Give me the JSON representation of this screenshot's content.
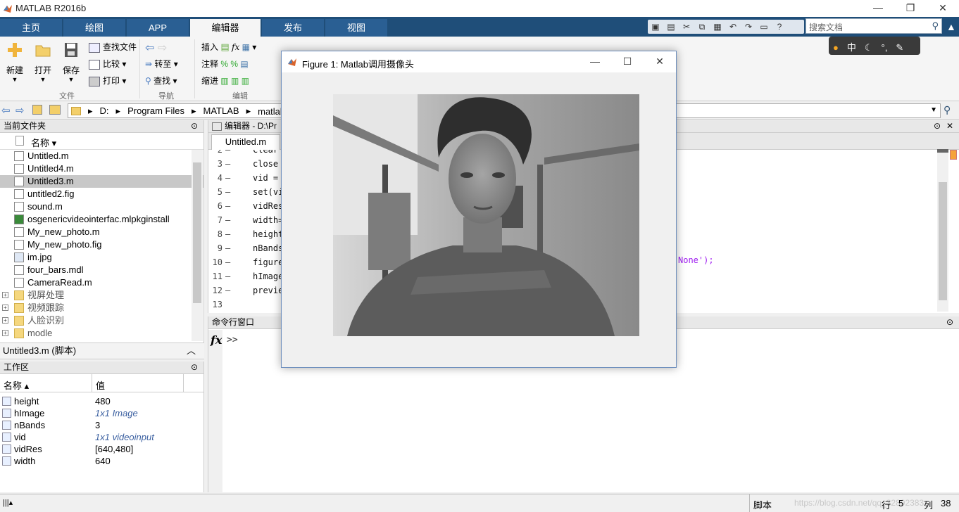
{
  "window": {
    "title": "MATLAB R2016b",
    "min": "—",
    "max": "❐",
    "close": "✕"
  },
  "tabs": [
    "主页",
    "绘图",
    "APP",
    "编辑器",
    "发布",
    "视图"
  ],
  "search": {
    "placeholder": "搜索文档"
  },
  "ribbon": {
    "new": "新建",
    "open": "打开",
    "save": "保存",
    "find_files": "查找文件",
    "compare": "比较",
    "print": "打印",
    "goto": "转至",
    "find": "查找",
    "insert": "插入",
    "comment": "注释",
    "indent": "缩进",
    "group_file": "文件",
    "group_nav": "导航",
    "group_edit": "编辑"
  },
  "lang_bar": {
    "label": "中"
  },
  "path": [
    "D:",
    "Program Files",
    "MATLAB",
    "matlab代码"
  ],
  "file_panel": {
    "title": "当前文件夹",
    "col_name": "名称",
    "files": [
      {
        "name": "Untitled.m",
        "type": "m"
      },
      {
        "name": "Untitled4.m",
        "type": "m"
      },
      {
        "name": "Untitled3.m",
        "type": "m",
        "selected": true
      },
      {
        "name": "untitled2.fig",
        "type": "fig"
      },
      {
        "name": "sound.m",
        "type": "m"
      },
      {
        "name": "osgenericvideointerfac.mlpkginstall",
        "type": "pkg"
      },
      {
        "name": "My_new_photo.m",
        "type": "m"
      },
      {
        "name": "My_new_photo.fig",
        "type": "fig"
      },
      {
        "name": "im.jpg",
        "type": "jpg"
      },
      {
        "name": "four_bars.mdl",
        "type": "mdl"
      },
      {
        "name": "CameraRead.m",
        "type": "m"
      }
    ],
    "folders": [
      "视屏处理",
      "视频跟踪",
      "人脸识别",
      "modle"
    ]
  },
  "details": {
    "label": "Untitled3.m  (脚本)"
  },
  "workspace": {
    "title": "工作区",
    "col_name": "名称",
    "col_value": "值",
    "vars": [
      {
        "name": "height",
        "value": "480",
        "obj": false
      },
      {
        "name": "hImage",
        "value": "1x1 Image",
        "obj": true
      },
      {
        "name": "nBands",
        "value": "3",
        "obj": false
      },
      {
        "name": "vid",
        "value": "1x1 videoinput",
        "obj": true
      },
      {
        "name": "vidRes",
        "value": "[640,480]",
        "obj": false
      },
      {
        "name": "width",
        "value": "640",
        "obj": false
      }
    ]
  },
  "editor": {
    "title": "编辑器 - D:\\Pr",
    "tab": "Untitled.m",
    "lines": [
      {
        "n": "2",
        "code": "clear"
      },
      {
        "n": "3",
        "code": "close"
      },
      {
        "n": "4",
        "code": "vid ="
      },
      {
        "n": "5",
        "code": "set(vi"
      },
      {
        "n": "6",
        "code": "vidRes"
      },
      {
        "n": "7",
        "code": "width="
      },
      {
        "n": "8",
        "code": "height"
      },
      {
        "n": "9",
        "code": "nBands"
      },
      {
        "n": "10",
        "code": "figure"
      },
      {
        "n": "11",
        "code": "hImage"
      },
      {
        "n": "12",
        "code": "previe"
      },
      {
        "n": "13",
        "code": ""
      }
    ],
    "tail_line10": "None');"
  },
  "command": {
    "title": "命令行窗口",
    "prompt": ">>",
    "fx": "fx"
  },
  "figure": {
    "title": "Figure 1: Matlab调用摄像头",
    "min": "—",
    "max": "☐",
    "close": "✕"
  },
  "status": {
    "mode": "脚本",
    "row_label": "行",
    "row": "5",
    "col_label": "列",
    "col": "38",
    "watermark": "https://blog.csdn.net/qq_32892383"
  }
}
